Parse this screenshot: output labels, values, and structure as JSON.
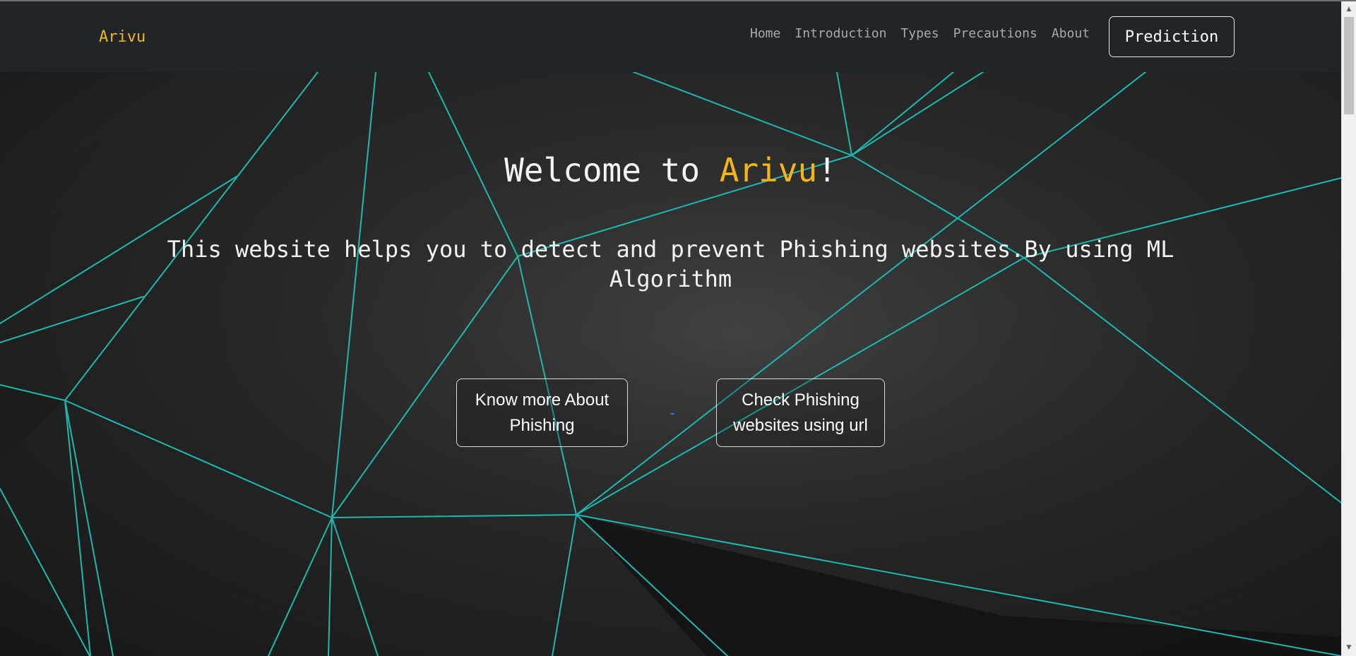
{
  "nav": {
    "brand": "Arivu",
    "links": [
      "Home",
      "Introduction",
      "Types",
      "Precautions",
      "About"
    ],
    "cta": "Prediction"
  },
  "hero": {
    "title_prefix": "Welcome to ",
    "title_accent": "Arivu",
    "title_suffix": "!",
    "subtitle": "This website helps you to detect and prevent Phishing websites.By using ML Algorithm",
    "buttons": [
      "Know more About Phishing",
      "Check Phishing websites using url"
    ]
  },
  "colors": {
    "accent": "#f5b518",
    "navbar": "#212529",
    "lines": "#1fb8b0"
  },
  "icons": {
    "scroll_up": "triangle-up-icon",
    "scroll_down": "triangle-down-icon"
  }
}
